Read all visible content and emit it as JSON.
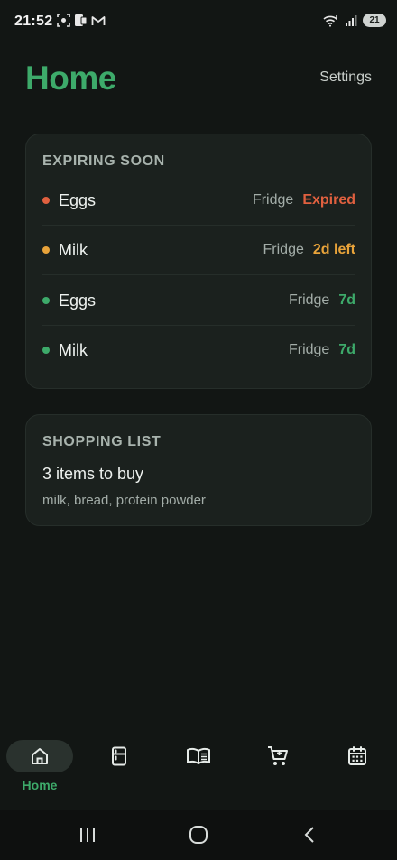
{
  "status_bar": {
    "time": "21:52",
    "battery": "21",
    "icons": [
      "screenshot-icon",
      "cast-icon",
      "gmail-icon",
      "wifi-icon",
      "signal-icon",
      "battery-icon"
    ]
  },
  "header": {
    "title": "Home",
    "settings_label": "Settings"
  },
  "expiring": {
    "heading": "EXPIRING SOON",
    "items": [
      {
        "name": "Eggs",
        "location": "Fridge",
        "status": "Expired",
        "color": "#e0603f"
      },
      {
        "name": "Milk",
        "location": "Fridge",
        "status": "2d left",
        "color": "#e8a33a"
      },
      {
        "name": "Eggs",
        "location": "Fridge",
        "status": "7d",
        "color": "#3daa6a"
      },
      {
        "name": "Milk",
        "location": "Fridge",
        "status": "7d",
        "color": "#3daa6a"
      }
    ]
  },
  "shopping": {
    "heading": "SHOPPING LIST",
    "count_text": "3 items to buy",
    "items_text": "milk, bread, protein powder"
  },
  "bottom_nav": {
    "items": [
      {
        "icon": "home-icon",
        "label": "Home",
        "active": true
      },
      {
        "icon": "fridge-icon",
        "label": "",
        "active": false
      },
      {
        "icon": "recipes-book-icon",
        "label": "",
        "active": false
      },
      {
        "icon": "cart-icon",
        "label": "",
        "active": false
      },
      {
        "icon": "calendar-icon",
        "label": "",
        "active": false
      }
    ]
  },
  "colors": {
    "accent": "#3daa6a",
    "background": "#121614",
    "card": "#1b211e",
    "expired": "#e0603f",
    "warning": "#e8a33a"
  }
}
